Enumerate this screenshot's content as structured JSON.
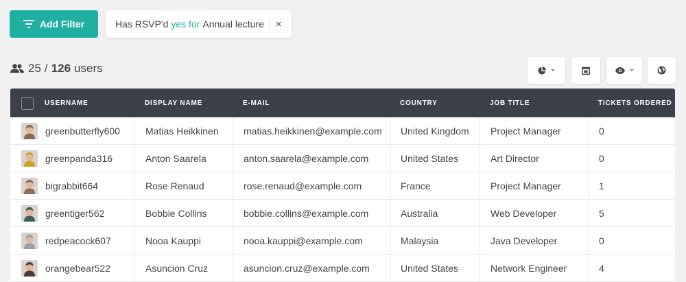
{
  "toolbar": {
    "add_filter_label": "Add Filter"
  },
  "filter": {
    "prefix": "Has RSVP'd",
    "accent": "yes for",
    "subject": "Annual lecture",
    "close_glyph": "×"
  },
  "summary": {
    "shown": "25",
    "separator": "/",
    "total": "126",
    "unit": "users"
  },
  "toolbuttons": [
    {
      "icon": "pie-chart-icon",
      "has_dropdown": true
    },
    {
      "icon": "calendar-icon",
      "has_dropdown": false
    },
    {
      "icon": "eye-icon",
      "has_dropdown": true
    },
    {
      "icon": "globe-icon",
      "has_dropdown": false
    }
  ],
  "table": {
    "columns": [
      "USERNAME",
      "DISPLAY NAME",
      "E-MAIL",
      "COUNTRY",
      "JOB TITLE",
      "TICKETS ORDERED"
    ],
    "rows": [
      {
        "username": "greenbutterfly600",
        "display": "Matias Heikkinen",
        "email": "matias.heikkinen@example.com",
        "country": "United Kingdom",
        "job": "Project Manager",
        "tickets": "0",
        "avatar_color": "#8a6a55"
      },
      {
        "username": "greenpanda316",
        "display": "Anton Saarela",
        "email": "anton.saarela@example.com",
        "country": "United States",
        "job": "Art Director",
        "tickets": "0",
        "avatar_color": "#c9a227"
      },
      {
        "username": "bigrabbit664",
        "display": "Rose Renaud",
        "email": "rose.renaud@example.com",
        "country": "France",
        "job": "Project Manager",
        "tickets": "1",
        "avatar_color": "#8b6b5c"
      },
      {
        "username": "greentiger562",
        "display": "Bobbie Collins",
        "email": "bobbie.collins@example.com",
        "country": "Australia",
        "job": "Web Developer",
        "tickets": "5",
        "avatar_color": "#3f5f5a"
      },
      {
        "username": "redpeacock607",
        "display": "Nooa Kauppi",
        "email": "nooa.kauppi@example.com",
        "country": "Malaysia",
        "job": "Java Developer",
        "tickets": "0",
        "avatar_color": "#9a9ea3"
      },
      {
        "username": "orangebear522",
        "display": "Asuncion Cruz",
        "email": "asuncion.cruz@example.com",
        "country": "United States",
        "job": "Network Engineer",
        "tickets": "4",
        "avatar_color": "#4a3a3a"
      }
    ]
  },
  "colors": {
    "accent": "#1fb0a1",
    "header_bg": "#3c4048",
    "page_bg": "#f1f1f1"
  }
}
